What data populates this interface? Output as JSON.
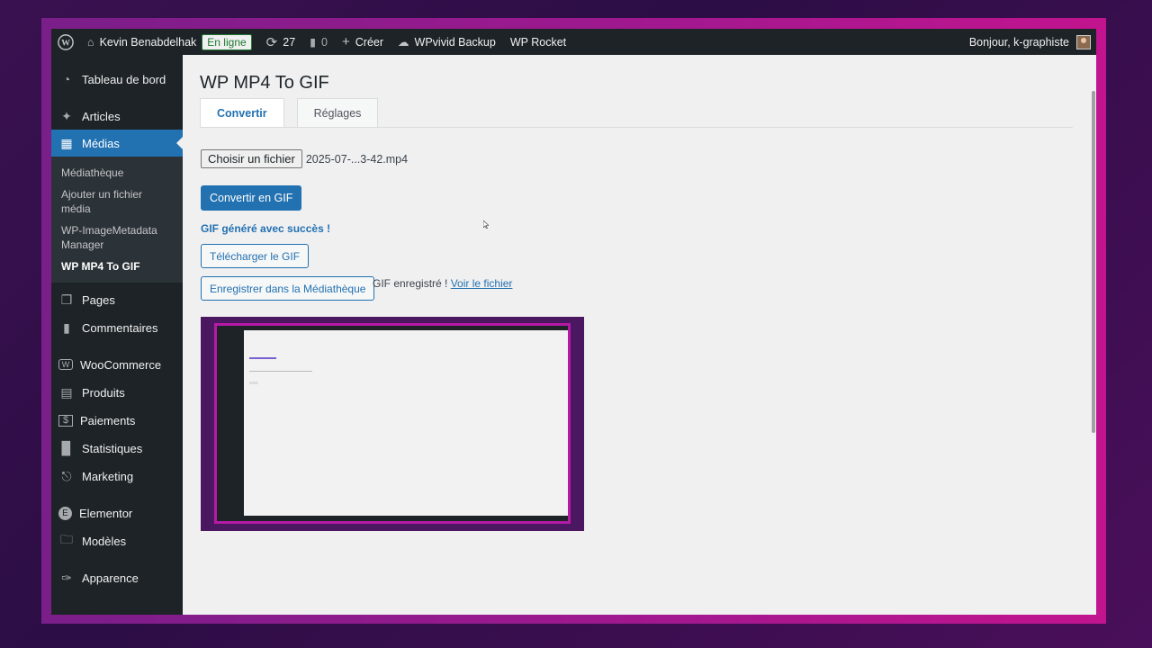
{
  "adminbar": {
    "site_name": "Kevin Benabdelhak",
    "status_badge": "En ligne",
    "updates_count": "27",
    "comments_count": "0",
    "new_label": "Créer",
    "backup_label": "WPvivid Backup",
    "rocket_label": "WP Rocket",
    "greeting": "Bonjour, k-graphiste"
  },
  "sidebar": {
    "items": [
      {
        "label": "Tableau de bord",
        "icon": "dashboard-icon"
      },
      {
        "label": "Articles",
        "icon": "pin-icon"
      },
      {
        "label": "Médias",
        "icon": "media-icon"
      },
      {
        "label": "Pages",
        "icon": "pages-icon"
      },
      {
        "label": "Commentaires",
        "icon": "comment-icon"
      },
      {
        "label": "WooCommerce",
        "icon": "woo-icon"
      },
      {
        "label": "Produits",
        "icon": "archive-icon"
      },
      {
        "label": "Paiements",
        "icon": "payment-icon"
      },
      {
        "label": "Statistiques",
        "icon": "chart-icon"
      },
      {
        "label": "Marketing",
        "icon": "megaphone-icon"
      },
      {
        "label": "Elementor",
        "icon": "elementor-icon"
      },
      {
        "label": "Modèles",
        "icon": "folder-icon"
      },
      {
        "label": "Apparence",
        "icon": "brush-icon"
      }
    ],
    "submenu": [
      {
        "label": "Médiathèque"
      },
      {
        "label": "Ajouter un fichier média"
      },
      {
        "label": "WP-ImageMetadataManager"
      },
      {
        "label": "WP MP4 To GIF"
      }
    ]
  },
  "main": {
    "title": "WP MP4 To GIF",
    "tabs": [
      {
        "label": "Convertir"
      },
      {
        "label": "Réglages"
      }
    ],
    "file_button": "Choisir un fichier",
    "file_name": "2025-07-...3-42.mp4",
    "convert_button": "Convertir en GIF",
    "success_message": "GIF généré avec succès !",
    "download_button": "Télécharger le GIF",
    "save_button": "Enregistrer dans la Médiathèque",
    "saved_message": "GIF enregistré !",
    "view_file_link": "Voir le fichier"
  },
  "colors": {
    "accent": "#2271b1",
    "admin_dark": "#1d2327"
  }
}
